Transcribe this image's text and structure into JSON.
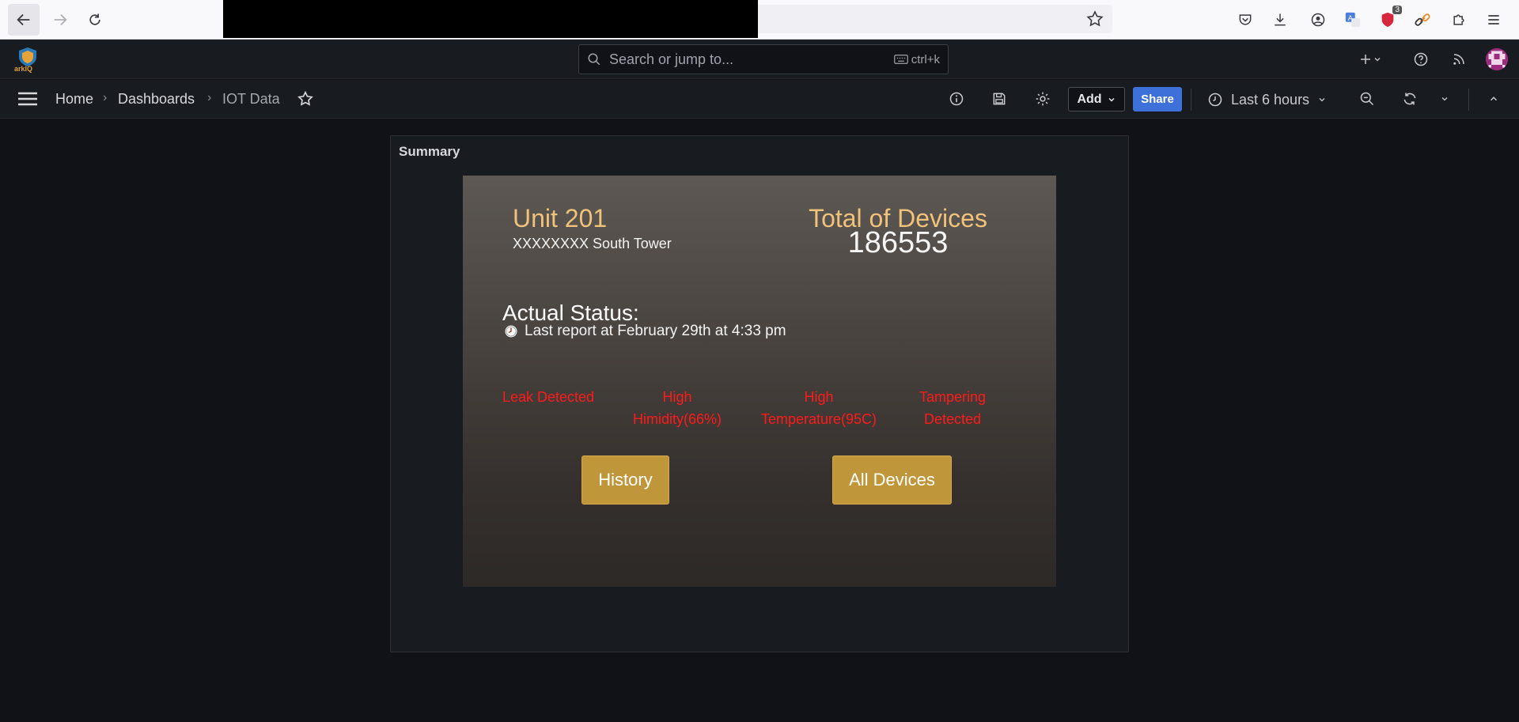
{
  "browser": {
    "extension_badge": "3"
  },
  "topbar": {
    "search_placeholder": "Search or jump to...",
    "search_shortcut": "ctrl+k",
    "logo_text": "arkIQ"
  },
  "breadcrumb": {
    "home": "Home",
    "dashboards": "Dashboards",
    "current": "IOT Data"
  },
  "toolbar": {
    "add_label": "Add",
    "share_label": "Share",
    "time_range": "Last 6 hours"
  },
  "panel": {
    "title": "Summary",
    "unit_title": "Unit 201",
    "unit_subtitle": "XXXXXXXX South Tower",
    "total_title": "Total of Devices",
    "total_value": "186553",
    "status_title": "Actual Status:",
    "status_report": "Last report at February 29th at 4:33 pm",
    "alerts": [
      {
        "line1": "Leak Detected",
        "line2": ""
      },
      {
        "line1": "High",
        "line2": "Himidity(66%)"
      },
      {
        "line1": "High",
        "line2": "Temperature(95C)"
      },
      {
        "line1": "Tampering",
        "line2": "Detected"
      }
    ],
    "history_button": "History",
    "all_devices_button": "All Devices"
  },
  "colors": {
    "accent_gold": "#f0c27a",
    "button_gold": "#c0963a",
    "alert_red": "#ff1a1a",
    "share_blue": "#3d71d9",
    "background": "#111217"
  }
}
